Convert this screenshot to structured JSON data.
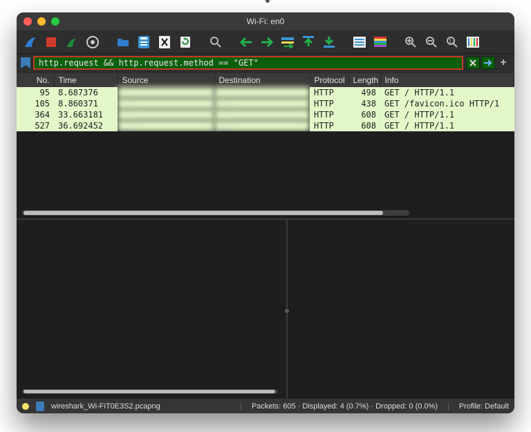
{
  "window": {
    "title": "Wi-Fi: en0"
  },
  "toolbar_icons": [
    "shark-fin-icon",
    "stop-icon",
    "restart-icon",
    "options-icon",
    "open-icon",
    "save-icon",
    "close-file-icon",
    "reload-icon",
    "find-icon",
    "go-back-icon",
    "go-forward-icon",
    "go-to-icon",
    "first-icon",
    "last-icon",
    "auto-scroll-icon",
    "colorize-icon",
    "zoom-in-icon",
    "zoom-out-icon",
    "zoom-reset-icon",
    "columns-icon"
  ],
  "filter": {
    "value": "http.request && http.request.method == \"GET\"",
    "clear_icon": "clear-filter-icon",
    "apply_icon": "apply-filter-icon",
    "add_label": "+"
  },
  "columns": [
    "No.",
    "Time",
    "Source",
    "Destination",
    "Protocol",
    "Length",
    "Info"
  ],
  "rows": [
    {
      "no": "95",
      "time": "8.687376",
      "src": "···",
      "dst": "···",
      "proto": "HTTP",
      "len": "498",
      "info": "GET / HTTP/1.1"
    },
    {
      "no": "105",
      "time": "8.860371",
      "src": "···",
      "dst": "···",
      "proto": "HTTP",
      "len": "438",
      "info": "GET /favicon.ico HTTP/1"
    },
    {
      "no": "364",
      "time": "33.663181",
      "src": "···",
      "dst": "···",
      "proto": "HTTP",
      "len": "608",
      "info": "GET / HTTP/1.1"
    },
    {
      "no": "527",
      "time": "36.692452",
      "src": "···",
      "dst": "···",
      "proto": "HTTP",
      "len": "608",
      "info": "GET / HTTP/1.1"
    }
  ],
  "status": {
    "filename": "wireshark_Wi-FiT0E3S2.pcapng",
    "packets": "Packets: 605 · Displayed: 4 (0.7%) · Dropped: 0 (0.0%)",
    "profile": "Profile: Default"
  }
}
